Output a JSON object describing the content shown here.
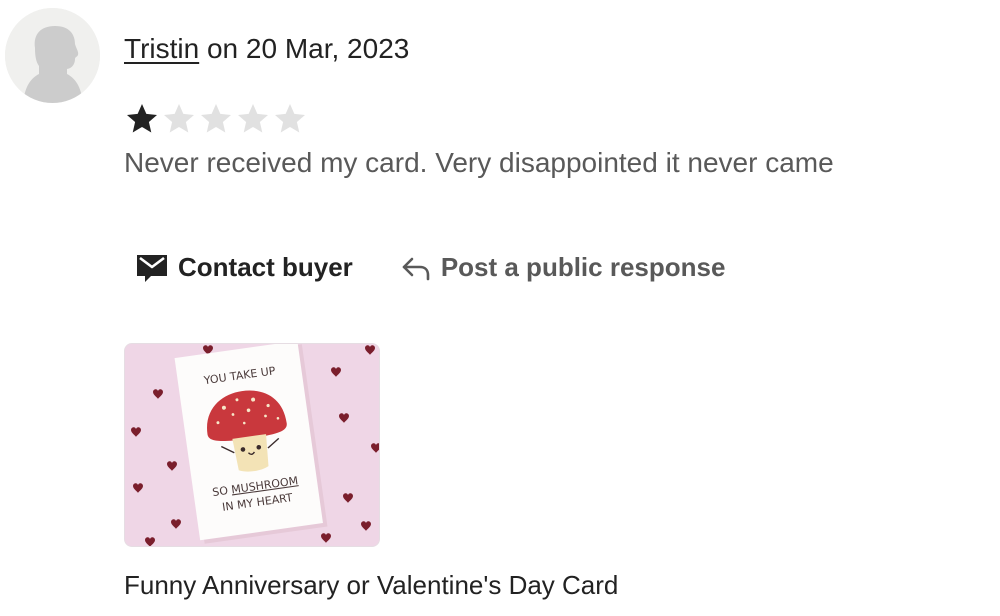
{
  "review": {
    "reviewer_name": "Tristin",
    "date_text": "on 20 Mar, 2023",
    "rating": 1,
    "max_rating": 5,
    "text": "Never received my card. Very disappointed it never came"
  },
  "actions": {
    "contact_buyer": "Contact buyer",
    "post_public_response": "Post a public response"
  },
  "listing": {
    "title": "Funny Anniversary or Valentine's Day Card",
    "card_line_1": "YOU TAKE UP",
    "card_line_2_prefix": "SO ",
    "card_line_2_emphasis": "MUSHROOM",
    "card_line_3": "IN MY HEART"
  },
  "colors": {
    "star_filled": "#222222",
    "star_empty": "#e1e1e1",
    "muted_text": "#595959",
    "thumb_background": "#efd6e6",
    "mushroom_cap": "#c9383d"
  },
  "icons": {
    "contact": "envelope-icon",
    "public_response": "reply-arrow-icon",
    "avatar": "default-user-avatar"
  }
}
